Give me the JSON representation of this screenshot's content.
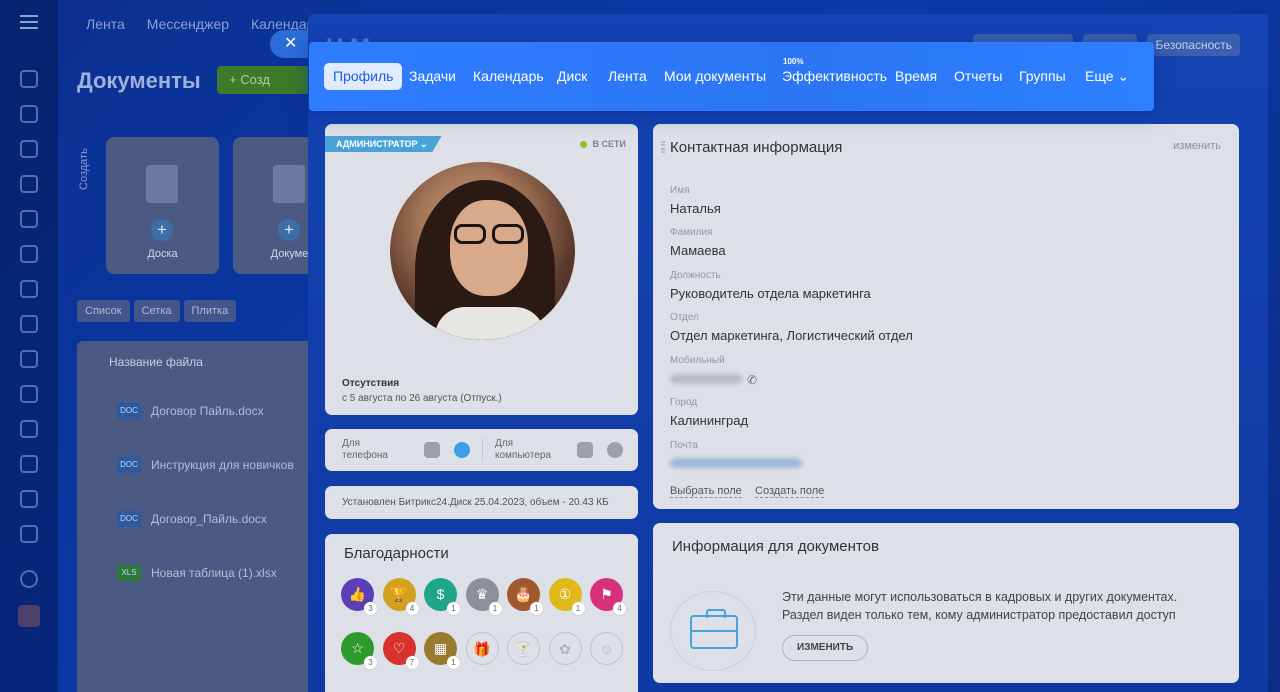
{
  "background_app": {
    "top_nav": [
      "Лента",
      "Мессенджер",
      "Календарь"
    ],
    "page_title": "Документы",
    "create_button": "+ Созд",
    "create_vertical": "Создать",
    "cards": [
      {
        "badge": "BOARD",
        "label": "Доска"
      },
      {
        "badge": "DOC",
        "label": "Докуме"
      }
    ],
    "view_tabs": [
      "Список",
      "Сетка",
      "Плитка"
    ],
    "list_header": "Название файла",
    "files": [
      {
        "type": "DOC",
        "name": "Договор Пайль.docx"
      },
      {
        "type": "DOC",
        "name": "Инструкция для новичков"
      },
      {
        "type": "DOC",
        "name": "Договор_Пайль.docx"
      },
      {
        "type": "XLS",
        "name": "Новая таблица (1).xlsx"
      }
    ]
  },
  "panel": {
    "title_fragment": "Н     М",
    "top_buttons": [
      "",
      "",
      "Безопасность"
    ]
  },
  "tabs": [
    {
      "label": "Профиль",
      "active": true
    },
    {
      "label": "Задачи"
    },
    {
      "label": "Календарь"
    },
    {
      "label": "Диск"
    },
    {
      "label": "Лента"
    },
    {
      "label": "Мои документы"
    },
    {
      "label": "Эффективность",
      "sup": "100%"
    },
    {
      "label": "Время"
    },
    {
      "label": "Отчеты"
    },
    {
      "label": "Группы"
    },
    {
      "label": "Еще ⌄"
    }
  ],
  "profile": {
    "role_badge": "АДМИНИСТРАТОР ⌄",
    "status": "В СЕТИ",
    "absence_title": "Отсутствия",
    "absence_text": "с 5 августа по 26 августа (Отпуск.)"
  },
  "apps": {
    "phone_label": "Для\nтелефона",
    "desktop_label": "Для\nкомпьютера"
  },
  "install_info": "Установлен Битрикс24.Диск 25.04.2023, объем - 20.43 КБ",
  "thanks": {
    "title": "Благодарности",
    "badges": [
      {
        "icon": "like-icon",
        "color": "#5b3fb8",
        "glyph": "👍",
        "count": "3"
      },
      {
        "icon": "trophy-icon",
        "color": "#d4a020",
        "glyph": "🏆",
        "count": "4"
      },
      {
        "icon": "money-icon",
        "color": "#1fa58a",
        "glyph": "$",
        "count": "1"
      },
      {
        "icon": "crown-icon",
        "color": "#8c9199",
        "glyph": "♛",
        "count": "1"
      },
      {
        "icon": "cake-icon",
        "color": "#a0582e",
        "glyph": "🎂",
        "count": "1"
      },
      {
        "icon": "coin-icon",
        "color": "#e0b81a",
        "glyph": "①",
        "count": "1"
      },
      {
        "icon": "flag-icon",
        "color": "#d6317a",
        "glyph": "⚑",
        "count": "4"
      },
      {
        "icon": "star-icon",
        "color": "#2e9a2e",
        "glyph": "☆",
        "count": "3"
      },
      {
        "icon": "heart-icon",
        "color": "#d6322e",
        "glyph": "♡",
        "count": "7"
      },
      {
        "icon": "calendar-icon",
        "color": "#9a7a30",
        "glyph": "▦",
        "count": "1"
      },
      {
        "icon": "gift-icon",
        "color": "",
        "glyph": "🎁",
        "count": ""
      },
      {
        "icon": "cocktail-icon",
        "color": "",
        "glyph": "🍸",
        "count": ""
      },
      {
        "icon": "flower-icon",
        "color": "",
        "glyph": "✿",
        "count": ""
      },
      {
        "icon": "smile-icon",
        "color": "",
        "glyph": "☺",
        "count": ""
      }
    ]
  },
  "contact": {
    "title": "Контактная информация",
    "edit": "изменить",
    "fields": [
      {
        "label": "Имя",
        "value": "Наталья"
      },
      {
        "label": "Фамилия",
        "value": "Мамаева"
      },
      {
        "label": "Должность",
        "value": "Руководитель отдела маркетинга"
      },
      {
        "label": "Отдел",
        "value": "Отдел маркетинга, Логистический отдел"
      },
      {
        "label": "Мобильный",
        "value": ""
      },
      {
        "label": "Город",
        "value": "Калининград"
      },
      {
        "label": "Почта",
        "value": ""
      }
    ],
    "select_field": "Выбрать поле",
    "create_field": "Создать поле"
  },
  "docs_info": {
    "title": "Информация для документов",
    "text": "Эти данные могут использоваться в кадровых и других документах. Раздел виден только тем, кому администратор предоставил доступ",
    "button": "ИЗМЕНИТЬ"
  }
}
